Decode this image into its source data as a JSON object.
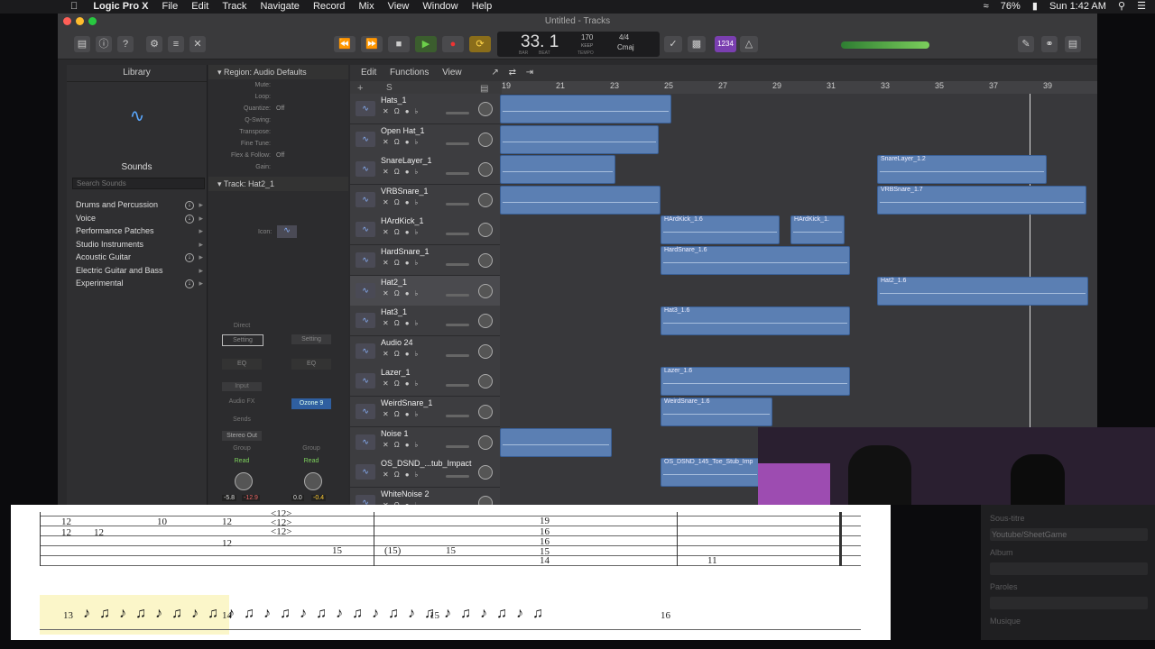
{
  "menubar": {
    "app": "Logic Pro X",
    "items": [
      "File",
      "Edit",
      "Track",
      "Navigate",
      "Record",
      "Mix",
      "View",
      "Window",
      "Help"
    ],
    "battery": "76%",
    "clock": "Sun 1:42 AM"
  },
  "window": {
    "title": "Untitled - Tracks"
  },
  "lcd": {
    "position": "33. 1",
    "bar_label": "BAR",
    "beat_label": "BEAT",
    "tempo": "170",
    "keep": "KEEP",
    "tempo_label": "TEMPO",
    "signature": "4/4",
    "key": "Cmaj",
    "count_in": "1234"
  },
  "library": {
    "title": "Library",
    "sounds_label": "Sounds",
    "search_placeholder": "Search Sounds",
    "items": [
      "Drums and Percussion",
      "Voice",
      "Performance Patches",
      "Studio Instruments",
      "Acoustic Guitar",
      "Electric Guitar and Bass",
      "Experimental"
    ]
  },
  "inspector": {
    "region_header": "Region: Audio Defaults",
    "rows": [
      {
        "k": "Mute:",
        "v": ""
      },
      {
        "k": "Loop:",
        "v": ""
      },
      {
        "k": "Quantize:",
        "v": "Off"
      },
      {
        "k": "Q-Swing:",
        "v": ""
      },
      {
        "k": "Transpose:",
        "v": ""
      },
      {
        "k": "Fine Tune:",
        "v": ""
      },
      {
        "k": "Flex & Follow:",
        "v": "Off"
      },
      {
        "k": "Gain:",
        "v": ""
      }
    ],
    "track_header": "Track:  Hat2_1",
    "icon_label": "Icon:",
    "strip": {
      "direct": "Direct",
      "setting": "Setting",
      "eq": "EQ",
      "input": "Input",
      "audio_fx": "Audio FX",
      "plugin": "Ozone 9",
      "sends": "Sends",
      "output": "Stereo Out",
      "group": "Group",
      "read": "Read",
      "vol1": "-5.8",
      "pk1": "-12.9",
      "vol2": "0.0",
      "pk2": "-0.4"
    }
  },
  "trackarea": {
    "menus": [
      "Edit",
      "Functions",
      "View"
    ],
    "ruler": [
      "19",
      "21",
      "23",
      "25",
      "27",
      "29",
      "31",
      "33",
      "35",
      "37",
      "39"
    ],
    "tracks": [
      "Hats_1",
      "Open Hat_1",
      "SnareLayer_1",
      "VRBSnare_1",
      "HArdKick_1",
      "HardSnare_1",
      "Hat2_1",
      "Hat3_1",
      "Audio 24",
      "Lazer_1",
      "WeirdSnare_1",
      "Noise 1",
      "OS_DSND_...tub_Impact",
      "WhiteNoise 2"
    ],
    "regions": [
      {
        "label": "",
        "lane": 0
      },
      {
        "label": "",
        "lane": 1
      },
      {
        "label": "",
        "lane": 2
      },
      {
        "label": "SnareLayer_1.2",
        "lane": 2
      },
      {
        "label": "",
        "lane": 3
      },
      {
        "label": "VRBSnare_1.7",
        "lane": 3
      },
      {
        "label": "HArdKick_1.6",
        "lane": 4
      },
      {
        "label": "HArdKick_1.",
        "lane": 4
      },
      {
        "label": "HardSnare_1.6",
        "lane": 5
      },
      {
        "label": "Hat2_1.6",
        "lane": 6
      },
      {
        "label": "Hat3_1.6",
        "lane": 7
      },
      {
        "label": "Lazer_1.6",
        "lane": 9
      },
      {
        "label": "WeirdSnare_1.6",
        "lane": 10
      },
      {
        "label": "",
        "lane": 11
      },
      {
        "label": "OS_DSND_145_Toe_Stub_Imp",
        "lane": 12
      }
    ]
  },
  "score": {
    "frets": [
      "12",
      "12",
      "12",
      "10",
      "12",
      "12",
      "<12>",
      "<12>",
      "<12>",
      "15",
      "(15)",
      "15",
      "19",
      "16",
      "16",
      "15",
      "14",
      "11"
    ],
    "measures": [
      "13",
      "14",
      "15",
      "16"
    ]
  },
  "scorepanel": {
    "lines": [
      "Sous-titre",
      "Youtube/SheetGame",
      "Album",
      "Paroles",
      "Musique"
    ]
  }
}
